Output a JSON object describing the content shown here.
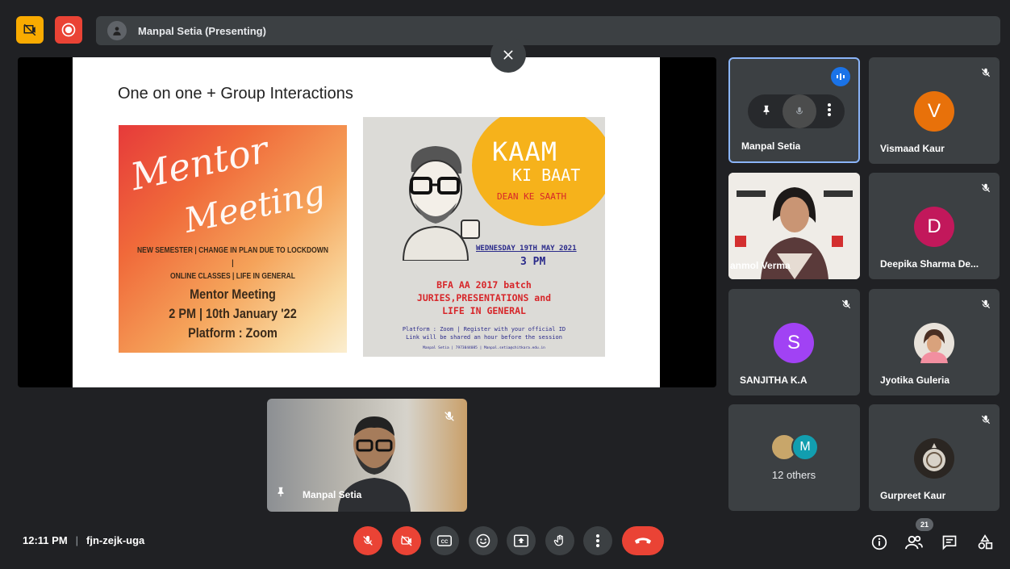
{
  "presenter": {
    "label": "Manpal Setia (Presenting)"
  },
  "slide": {
    "title": "One on one + Group Interactions",
    "poster1": {
      "script_line1": "Mentor",
      "script_line2": "Meeting",
      "topics_line1": "NEW SEMESTER | CHANGE IN PLAN DUE TO LOCKDOWN |",
      "topics_line2": "ONLINE CLASSES | LIFE IN GENERAL",
      "meeting_title": "Mentor Meeting",
      "meeting_time": "2 PM | 10th January '22",
      "meeting_platform": "Platform : Zoom"
    },
    "poster2": {
      "kaam": "KAAM",
      "ki_baat": "KI BAAT",
      "dean": "DEAN KE SAATH",
      "date": "WEDNESDAY 19TH MAY 2021",
      "time": "3 PM",
      "batch_line1": "BFA AA 2017 batch",
      "batch_line2": "JURIES,PRESENTATIONS and",
      "batch_line3": "LIFE IN GENERAL",
      "platform_line1": "Platform : Zoom  | Register with your official ID",
      "platform_line2": "Link will be shared an hour before the session",
      "contact": "Manpal Setia | 7973044085 | Manpal.setia@chitkara.edu.in"
    }
  },
  "self_view": {
    "name": "Manpal Setia"
  },
  "participants": [
    {
      "name": "Manpal Setia",
      "type": "active"
    },
    {
      "name": "Vismaad Kaur",
      "initial": "V",
      "color": "#e8710a"
    },
    {
      "name": "anmol Verma",
      "type": "camera"
    },
    {
      "name": "Deepika Sharma De...",
      "initial": "D",
      "color": "#c2185b"
    },
    {
      "name": "SANJITHA K.A",
      "initial": "S",
      "color": "#a142f4"
    },
    {
      "name": "Jyotika Guleria",
      "type": "photo"
    },
    {
      "name": "12 others",
      "initial": "M",
      "color": "#129eaf"
    },
    {
      "name": "Gurpreet Kaur",
      "type": "photo"
    }
  ],
  "meeting": {
    "time": "12:11 PM",
    "code": "fjn-zejk-uga"
  },
  "people_count": "21",
  "colors": {
    "accent": "#8ab4f8",
    "danger": "#ea4335",
    "surface": "#3c4043",
    "background": "#202124"
  }
}
